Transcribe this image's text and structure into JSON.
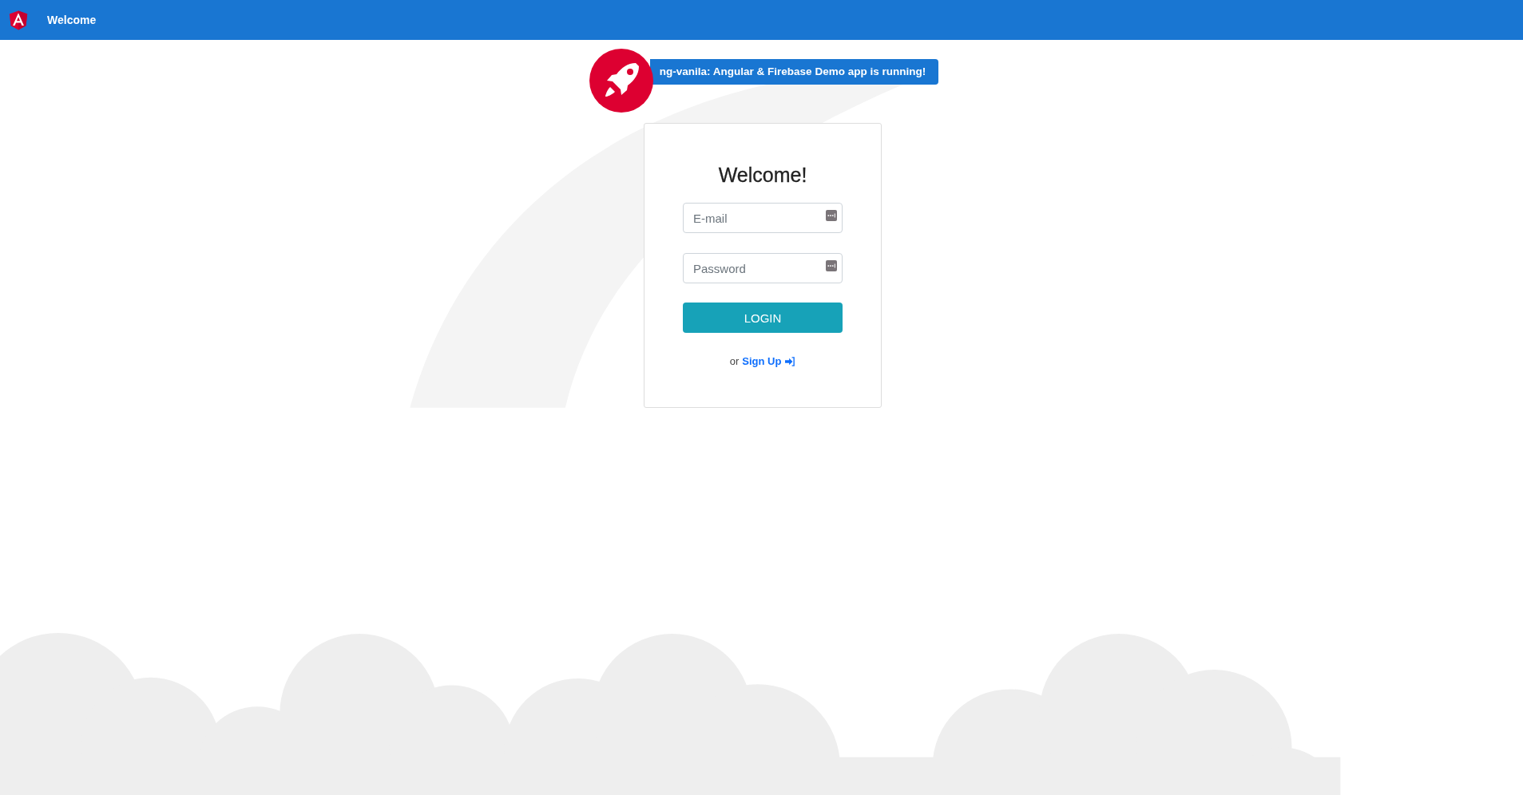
{
  "toolbar": {
    "title": "Welcome"
  },
  "banner": {
    "text": "ng-vanila: Angular & Firebase Demo app is running!"
  },
  "login_card": {
    "heading": "Welcome!",
    "fields": [
      {
        "placeholder": "E-mail"
      },
      {
        "placeholder": "Password"
      }
    ],
    "button": "LOGIN",
    "signup_prefix": "or",
    "signup_link": "Sign Up"
  }
}
